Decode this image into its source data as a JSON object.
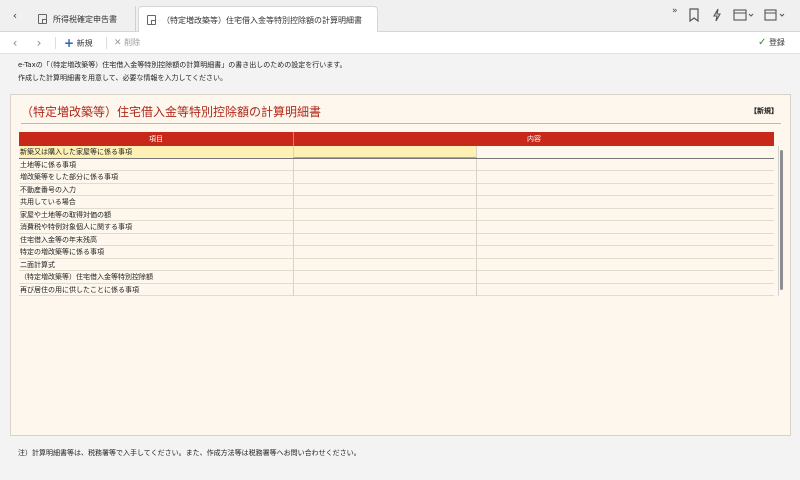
{
  "tabs": [
    {
      "label": "所得税確定申告書",
      "active": false
    },
    {
      "label": "（特定増改築等）住宅借入金等特別控除額の計算明細書",
      "active": true
    }
  ],
  "tabbar_icons": [
    "chevrons-right-icon",
    "bookmark-icon",
    "lightning-icon",
    "window-layout-icon",
    "calendar-icon"
  ],
  "toolbar": {
    "new_label": "新規",
    "delete_label": "削除",
    "register_label": "登録"
  },
  "intro": {
    "line1": "e-Taxの「（特定増改築等）住宅借入金等特別控除額の計算明細書」の書き出しのための設定を行います。",
    "line2": "作成した計算明細書を用意して、必要な情報を入力してください。"
  },
  "panel": {
    "title": "（特定増改築等）住宅借入金等特別控除額の計算明細書",
    "badge": "【新規】",
    "columns": [
      "項目",
      "内容"
    ],
    "rows": [
      "新築又は購入した家屋等に係る事項",
      "土地等に係る事項",
      "増改築等をした部分に係る事項",
      "不動産番号の入力",
      "共用している場合",
      "家屋や土地等の取得対価の額",
      "消費税や特例対象個人に関する事項",
      "住宅借入金等の年末残高",
      "特定の増改築等に係る事項",
      "二面計算式",
      "（特定増改築等）住宅借入金等特別控除額",
      "再び居住の用に供したことに係る事項"
    ]
  },
  "footnote": "注）計算明細書等は、税務署等で入手してください。また、作成方法等は税務署等へお問い合わせください。",
  "colors": {
    "accent": "#c8281a",
    "title": "#b0281a",
    "panel_bg": "#fdf7ee",
    "selected_row": "#fff1b6",
    "register_check": "#2e8b2e"
  }
}
